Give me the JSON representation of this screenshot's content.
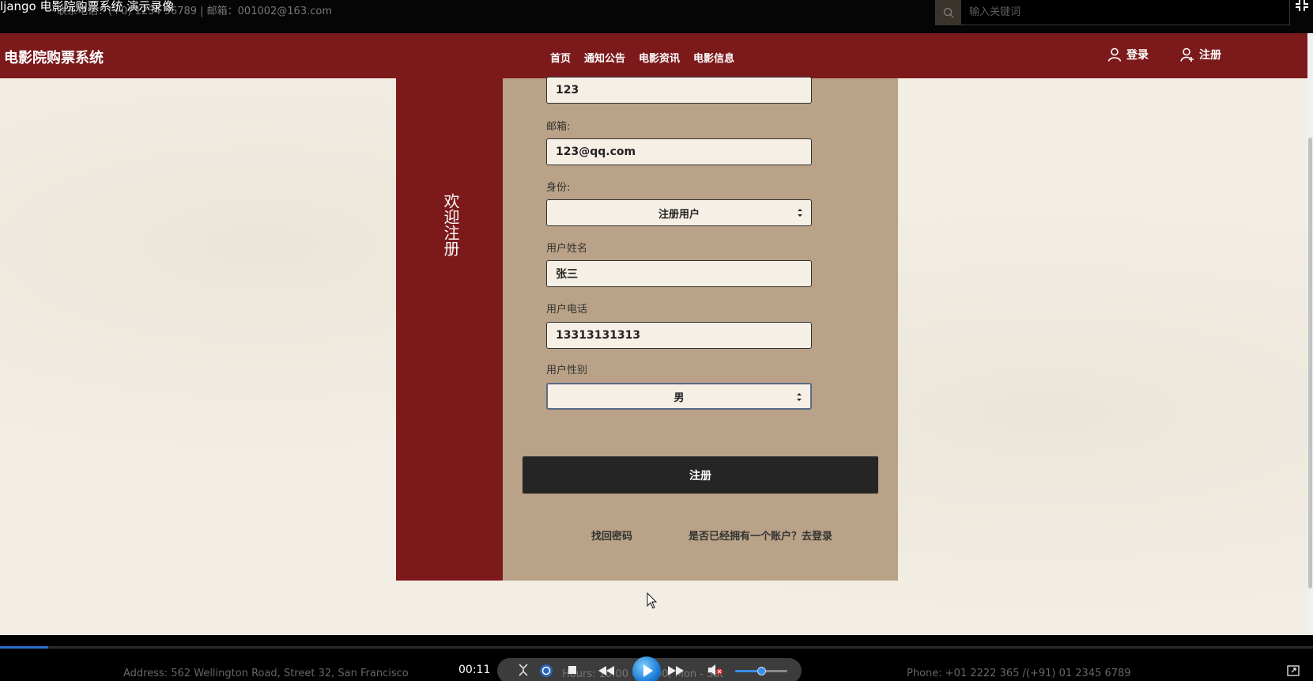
{
  "video": {
    "title": "ljango 电影院购票系统 演示录像",
    "contact_line": "联系电话：(+0) 1234 56789 | 邮箱：001002@163.com"
  },
  "search": {
    "placeholder": "输入关键词"
  },
  "header": {
    "brand": "电影院购票系统",
    "nav": [
      "首页",
      "通知公告",
      "电影资讯",
      "电影信息"
    ],
    "login_label": "登录",
    "register_label": "注册"
  },
  "form": {
    "welcome": "欢迎注册",
    "fields": {
      "top_value": "123",
      "email_label": "邮箱:",
      "email_value": "123@qq.com",
      "role_label": "身份:",
      "role_value": "注册用户",
      "name_label": "用户姓名",
      "name_value": "张三",
      "phone_label": "用户电话",
      "phone_value": "13313131313",
      "gender_label": "用户性别",
      "gender_value": "男"
    },
    "submit_label": "注册",
    "forgot_link": "找回密码",
    "login_link": "是否已经拥有一个账户？去登录"
  },
  "player": {
    "time": "00:11",
    "progress": 0.037,
    "volume": 0.5,
    "footer_address": "Address: 562 Wellington Road, Street 32, San Francisco",
    "footer_hours": "Hours: 10:00 - 18:00, Mon - Sat",
    "footer_phone": "Phone: +01 2222 365 /(+91) 01 2345 6789"
  },
  "colors": {
    "header_red": "#7c1a1b",
    "form_tan": "#b9a287",
    "page_cream": "#f3eee4",
    "button_dark": "#252525"
  }
}
